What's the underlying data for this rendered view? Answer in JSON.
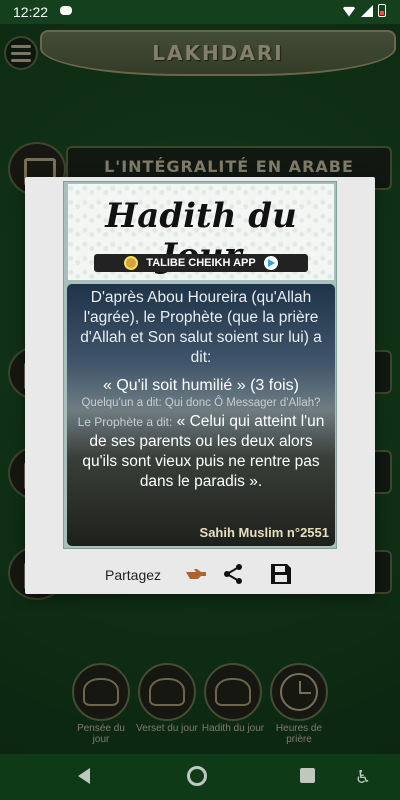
{
  "status": {
    "time": "12:22"
  },
  "header": {
    "title": "LAKHDARI"
  },
  "menu": {
    "items": [
      {
        "label": "L'INTÉGRALITÉ EN ARABE"
      }
    ]
  },
  "dialog": {
    "title": "Hadith du Jour",
    "app_name": "TALIBE CHEIKH APP",
    "intro": "D'après Abou Houreira (qu'Allah l'agrée), le Prophète (que la prière d'Allah et Son salut soient sur lui) a dit:",
    "quote1": "« Qu'il soit humilié » (3 fois)",
    "question": "Quelqu'un a dit: Qui donc Ô Messager d'Allah?",
    "prophet_lead": "Le Prophète a dit:",
    "quote2": "« Celui qui atteint l'un de ses parents ou les deux alors qu'ils sont vieux puis ne rentre pas dans le paradis ».",
    "source": "Sahih Muslim n°2551",
    "share_label": "Partagez"
  },
  "quick": [
    {
      "label": "Pensée du jour"
    },
    {
      "label": "Verset du jour"
    },
    {
      "label": "Hadith du jour"
    },
    {
      "label": "Heures de prière"
    }
  ],
  "colors": {
    "accent": "#1d5a2a",
    "banner": "#6f7f56",
    "text_light": "#e6ddbd"
  },
  "icons": [
    "menu-icon",
    "book-icon",
    "hand-point-icon",
    "share-icon",
    "save-icon",
    "back-icon",
    "home-icon",
    "recents-icon",
    "accessibility-icon"
  ]
}
